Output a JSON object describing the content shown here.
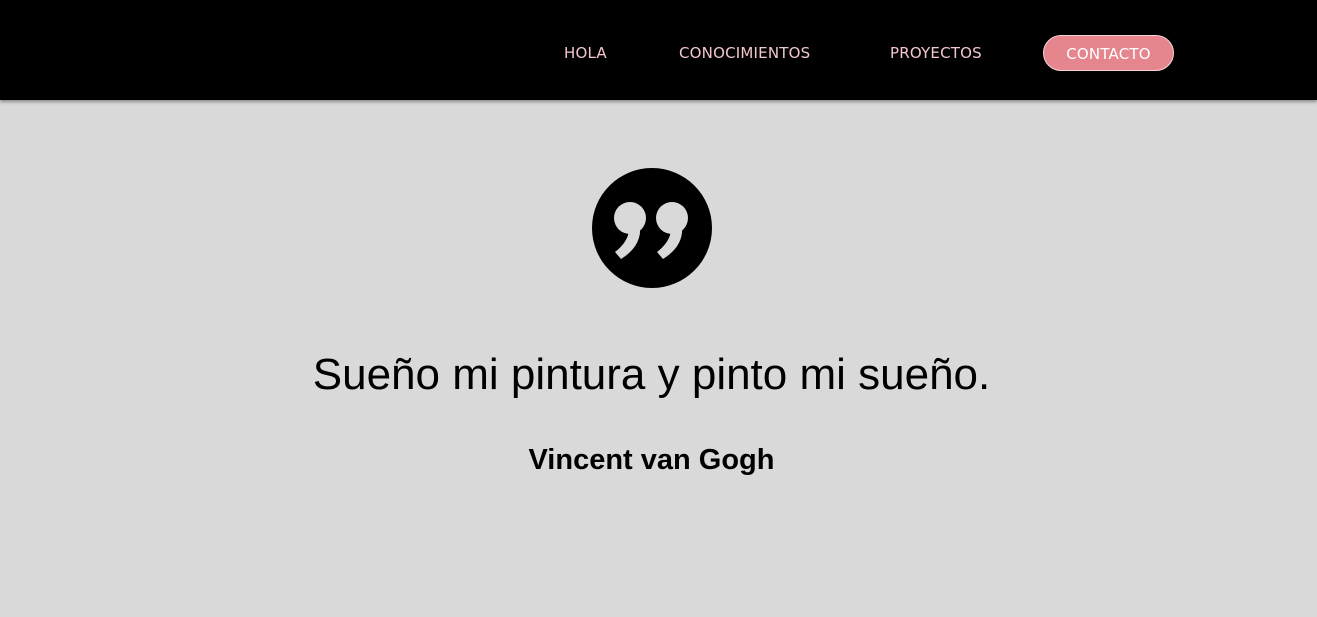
{
  "nav": {
    "items": [
      {
        "label": "HOLA"
      },
      {
        "label": "CONOCIMIENTOS"
      },
      {
        "label": "PROYECTOS"
      }
    ],
    "contact_label": "CONTACTO"
  },
  "quote": {
    "icon": "quote-icon",
    "text": "Sueño mi pintura y pinto mi sueño.",
    "author": "Vincent van Gogh"
  },
  "colors": {
    "background": "#dad9da",
    "navbar_bg": "#000000",
    "nav_text": "#f2c7cc",
    "accent": "#e5868f",
    "accent_text": "#ffffff",
    "text": "#000000"
  }
}
